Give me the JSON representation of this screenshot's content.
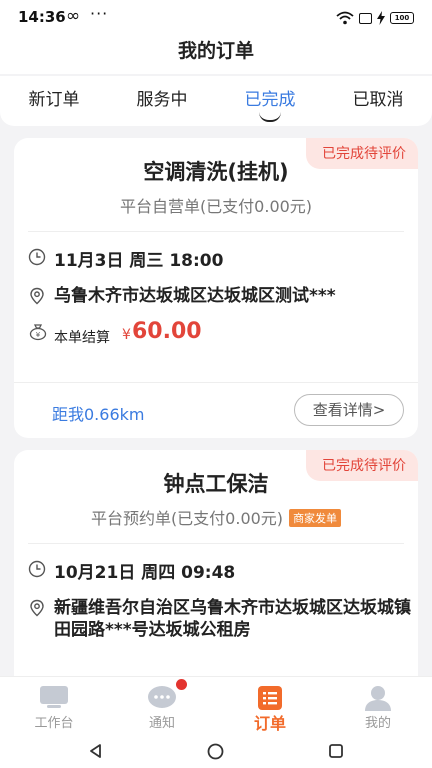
{
  "status_bar": {
    "time": "14:36",
    "icons": [
      "infinity-icon",
      "more-dots-icon",
      "wifi-icon",
      "sim-icon",
      "charging-icon",
      "battery-icon"
    ],
    "battery": "100"
  },
  "header": {
    "title": "我的订单"
  },
  "tabs": [
    {
      "label": "新订单",
      "active": false
    },
    {
      "label": "服务中",
      "active": false
    },
    {
      "label": "已完成",
      "active": true
    },
    {
      "label": "已取消",
      "active": false
    }
  ],
  "orders": [
    {
      "badge": "已完成待评价",
      "title": "空调清洗(挂机)",
      "subtitle": "平台自营单(已支付0.00元)",
      "time": "11月3日 周三 18:00",
      "address": "乌鲁木齐市达坂城区达坂城区测试***",
      "settle_label": "本单结算",
      "currency": "¥",
      "amount": "60.00",
      "distance": "距我0.66km",
      "detail_button": "查看详情>"
    },
    {
      "badge": "已完成待评价",
      "title": "钟点工保洁",
      "subtitle": "平台预约单(已支付0.00元)",
      "tag": "商家发单",
      "time": "10月21日 周四 09:48",
      "address": "新疆维吾尔自治区乌鲁木齐市达坂城区达坂城镇田园路***号达坂城公租房"
    }
  ],
  "tabbar": [
    {
      "label": "工作台",
      "icon": "workbench-icon",
      "active": false
    },
    {
      "label": "通知",
      "icon": "chat-bubble-icon",
      "active": false,
      "badge_dot": true
    },
    {
      "label": "订单",
      "icon": "order-list-icon",
      "active": true
    },
    {
      "label": "我的",
      "icon": "user-icon",
      "active": false
    }
  ],
  "colors": {
    "accent_blue": "#3a7be0",
    "badge_red": "#e2453a",
    "active_orange": "#f26b2b"
  }
}
